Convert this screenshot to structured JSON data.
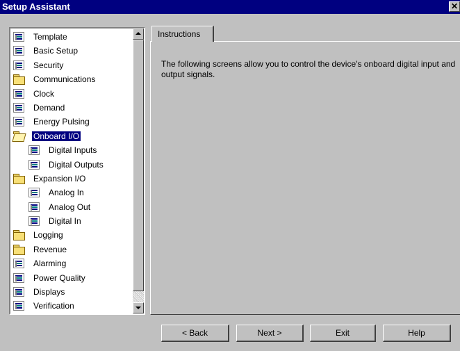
{
  "window": {
    "title": "Setup Assistant",
    "close_label": "✕"
  },
  "tree": {
    "items": [
      {
        "label": "Template",
        "icon": "doc-icon",
        "level": 0
      },
      {
        "label": "Basic Setup",
        "icon": "doc-icon",
        "level": 0
      },
      {
        "label": "Security",
        "icon": "doc-icon",
        "level": 0
      },
      {
        "label": "Communications",
        "icon": "folder-icon",
        "level": 0
      },
      {
        "label": "Clock",
        "icon": "doc-icon",
        "level": 0
      },
      {
        "label": "Demand",
        "icon": "doc-icon",
        "level": 0
      },
      {
        "label": "Energy Pulsing",
        "icon": "doc-icon",
        "level": 0
      },
      {
        "label": "Onboard I/O",
        "icon": "folder-open-icon",
        "level": 0,
        "selected": true
      },
      {
        "label": "Digital Inputs",
        "icon": "doc-icon",
        "level": 1
      },
      {
        "label": "Digital Outputs",
        "icon": "doc-icon",
        "level": 1
      },
      {
        "label": "Expansion I/O",
        "icon": "folder-icon",
        "level": 0
      },
      {
        "label": "Analog In",
        "icon": "doc-icon",
        "level": 1
      },
      {
        "label": "Analog Out",
        "icon": "doc-icon",
        "level": 1
      },
      {
        "label": "Digital In",
        "icon": "doc-icon",
        "level": 1
      },
      {
        "label": "Logging",
        "icon": "folder-icon",
        "level": 0
      },
      {
        "label": "Revenue",
        "icon": "folder-icon",
        "level": 0
      },
      {
        "label": "Alarming",
        "icon": "doc-icon",
        "level": 0
      },
      {
        "label": "Power Quality",
        "icon": "doc-icon",
        "level": 0
      },
      {
        "label": "Displays",
        "icon": "doc-icon",
        "level": 0
      },
      {
        "label": "Verification",
        "icon": "doc-icon",
        "level": 0
      }
    ]
  },
  "tab": {
    "label": "Instructions"
  },
  "instructions": {
    "text": "The following screens allow you to control the device's onboard digital input and output signals."
  },
  "buttons": {
    "back": "< Back",
    "next": "Next >",
    "exit": "Exit",
    "help": "Help"
  },
  "colors": {
    "titlebar": "#000080",
    "selection": "#000080",
    "face": "#c0c0c0"
  }
}
